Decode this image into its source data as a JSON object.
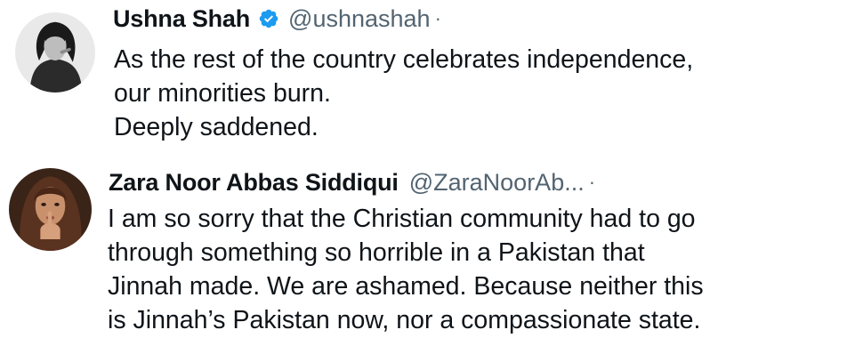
{
  "tweets": [
    {
      "author": {
        "display_name": "Ushna Shah",
        "handle": "@ushnashah",
        "separator": "·",
        "verified": true,
        "avatar_icon": "profile-avatar"
      },
      "text_lines": [
        "As the rest of the country celebrates independence,",
        "our minorities burn.",
        "Deeply saddened."
      ]
    },
    {
      "author": {
        "display_name": "Zara Noor Abbas Siddiqui",
        "handle": "@ZaraNoorAb...",
        "separator": "·",
        "verified": false,
        "avatar_icon": "profile-avatar"
      },
      "text_lines": [
        "I am so sorry that the Christian community had to go",
        "through something so horrible in a Pakistan that",
        "Jinnah made. We are ashamed. Because neither this",
        "is Jinnah’s Pakistan now, nor a compassionate state."
      ]
    }
  ],
  "colors": {
    "text_primary": "#0f1419",
    "text_secondary": "#536471",
    "verified_badge": "#1d9bf0",
    "background": "#ffffff"
  }
}
